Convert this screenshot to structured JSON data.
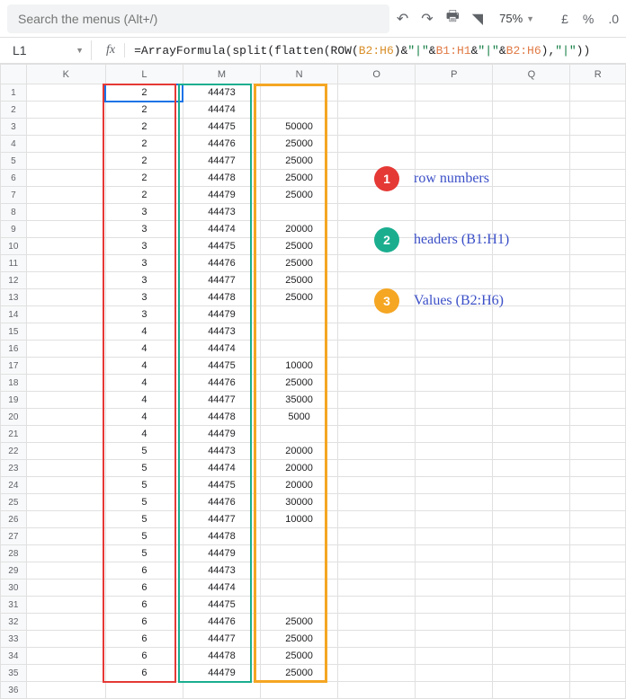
{
  "toolbar": {
    "search_placeholder": "Search the menus (Alt+/)",
    "zoom": "75%",
    "currency": "£",
    "percent": "%",
    "decimal": ".0"
  },
  "namebox": "L1",
  "fx": "fx",
  "formula": {
    "prefix": "=ArrayFormula(split(flatten(ROW(",
    "r1": "B2:H6",
    "mid1": ")&",
    "s1": "\"|\"",
    "mid2": "&",
    "r2": "B1:H1",
    "mid3": "&",
    "s2": "\"|\"",
    "mid4": "&",
    "r3": "B2:H6",
    "mid5": "),",
    "s3": "\"|\"",
    "suffix": "))"
  },
  "columns": [
    "K",
    "L",
    "M",
    "N",
    "O",
    "P",
    "Q",
    "R"
  ],
  "rows": [
    {
      "n": 1,
      "l": "2",
      "m": "44473",
      "v": ""
    },
    {
      "n": 2,
      "l": "2",
      "m": "44474",
      "v": ""
    },
    {
      "n": 3,
      "l": "2",
      "m": "44475",
      "v": "50000"
    },
    {
      "n": 4,
      "l": "2",
      "m": "44476",
      "v": "25000"
    },
    {
      "n": 5,
      "l": "2",
      "m": "44477",
      "v": "25000"
    },
    {
      "n": 6,
      "l": "2",
      "m": "44478",
      "v": "25000"
    },
    {
      "n": 7,
      "l": "2",
      "m": "44479",
      "v": "25000"
    },
    {
      "n": 8,
      "l": "3",
      "m": "44473",
      "v": ""
    },
    {
      "n": 9,
      "l": "3",
      "m": "44474",
      "v": "20000"
    },
    {
      "n": 10,
      "l": "3",
      "m": "44475",
      "v": "25000"
    },
    {
      "n": 11,
      "l": "3",
      "m": "44476",
      "v": "25000"
    },
    {
      "n": 12,
      "l": "3",
      "m": "44477",
      "v": "25000"
    },
    {
      "n": 13,
      "l": "3",
      "m": "44478",
      "v": "25000"
    },
    {
      "n": 14,
      "l": "3",
      "m": "44479",
      "v": ""
    },
    {
      "n": 15,
      "l": "4",
      "m": "44473",
      "v": ""
    },
    {
      "n": 16,
      "l": "4",
      "m": "44474",
      "v": ""
    },
    {
      "n": 17,
      "l": "4",
      "m": "44475",
      "v": "10000"
    },
    {
      "n": 18,
      "l": "4",
      "m": "44476",
      "v": "25000"
    },
    {
      "n": 19,
      "l": "4",
      "m": "44477",
      "v": "35000"
    },
    {
      "n": 20,
      "l": "4",
      "m": "44478",
      "v": "5000"
    },
    {
      "n": 21,
      "l": "4",
      "m": "44479",
      "v": ""
    },
    {
      "n": 22,
      "l": "5",
      "m": "44473",
      "v": "20000"
    },
    {
      "n": 23,
      "l": "5",
      "m": "44474",
      "v": "20000"
    },
    {
      "n": 24,
      "l": "5",
      "m": "44475",
      "v": "20000"
    },
    {
      "n": 25,
      "l": "5",
      "m": "44476",
      "v": "30000"
    },
    {
      "n": 26,
      "l": "5",
      "m": "44477",
      "v": "10000"
    },
    {
      "n": 27,
      "l": "5",
      "m": "44478",
      "v": ""
    },
    {
      "n": 28,
      "l": "5",
      "m": "44479",
      "v": ""
    },
    {
      "n": 29,
      "l": "6",
      "m": "44473",
      "v": ""
    },
    {
      "n": 30,
      "l": "6",
      "m": "44474",
      "v": ""
    },
    {
      "n": 31,
      "l": "6",
      "m": "44475",
      "v": ""
    },
    {
      "n": 32,
      "l": "6",
      "m": "44476",
      "v": "25000"
    },
    {
      "n": 33,
      "l": "6",
      "m": "44477",
      "v": "25000"
    },
    {
      "n": 34,
      "l": "6",
      "m": "44478",
      "v": "25000"
    },
    {
      "n": 35,
      "l": "6",
      "m": "44479",
      "v": "25000"
    },
    {
      "n": 36,
      "l": "",
      "m": "",
      "v": ""
    }
  ],
  "annotations": [
    {
      "num": "1",
      "label": "row numbers"
    },
    {
      "num": "2",
      "label": "headers (B1:H1)"
    },
    {
      "num": "3",
      "label": "Values (B2:H6)"
    }
  ]
}
